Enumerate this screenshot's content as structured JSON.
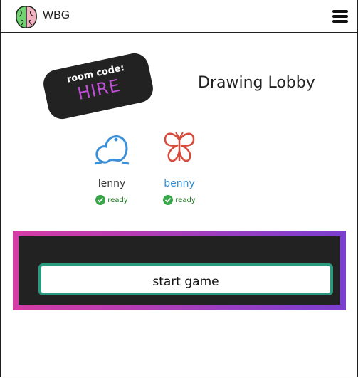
{
  "app": {
    "brand": "WBG"
  },
  "room": {
    "label": "room code:",
    "code": "HIRE"
  },
  "lobby": {
    "title": "Drawing Lobby"
  },
  "players": [
    {
      "name": "lenny",
      "status": "ready",
      "avatar": "frog-drawing",
      "name_color": "#333333"
    },
    {
      "name": "benny",
      "status": "ready",
      "avatar": "butterfly-drawing",
      "name_color": "#2f8fd8"
    }
  ],
  "actions": {
    "start_label": "start game"
  },
  "colors": {
    "accent_purple": "#c04fd8",
    "ready_green": "#1e7a1e",
    "button_border": "#2a9a7f"
  }
}
